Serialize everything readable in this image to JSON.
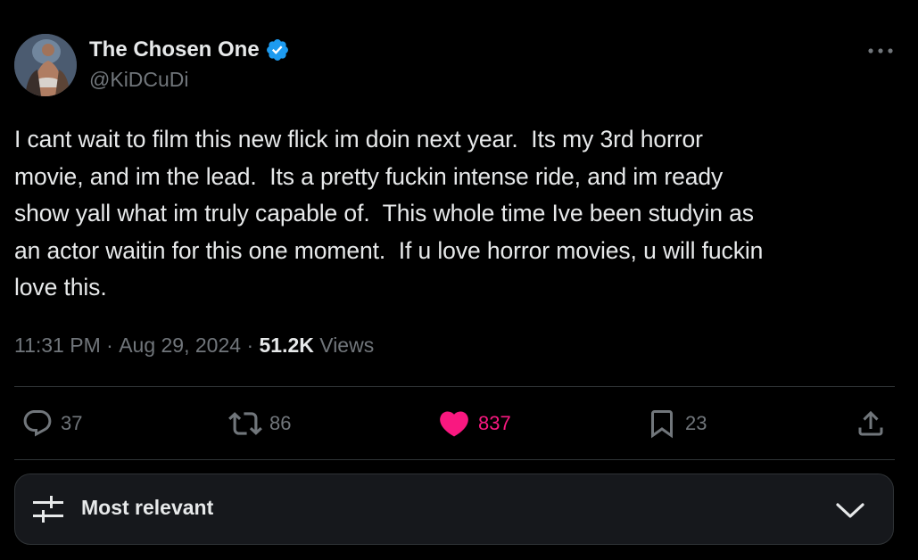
{
  "author": {
    "display_name": "The Chosen One",
    "handle": "@KiDCuDi",
    "verified": true,
    "avatar_icon": "profile-avatar"
  },
  "tweet": {
    "text": "I cant wait to film this new flick im doin next year.  Its my 3rd horror\nmovie, and im the lead.  Its a pretty fuckin intense ride, and im ready\nshow yall what im truly capable of.  This whole time Ive been studyin as\nan actor waitin for this one moment.  If u love horror movies, u will fuckin\nlove this.",
    "time": "11:31 PM",
    "separator": "·",
    "date": "Aug 29, 2024",
    "views_count": "51.2K",
    "views_label": "Views"
  },
  "actions": {
    "replies": "37",
    "reposts": "86",
    "likes": "837",
    "bookmarks": "23"
  },
  "sort": {
    "label": "Most relevant"
  },
  "colors": {
    "background": "#000000",
    "primary_text": "#e7e9ea",
    "secondary_text": "#71767b",
    "verified_blue": "#1d9bf0",
    "like_pink": "#f91880",
    "divider": "#2f3336"
  },
  "icons": {
    "more": "more-dots-icon",
    "reply": "reply-icon",
    "repost": "repost-icon",
    "like": "heart-icon",
    "bookmark": "bookmark-icon",
    "share": "share-icon",
    "sort": "sliders-icon",
    "expand": "chevron-down-icon"
  }
}
